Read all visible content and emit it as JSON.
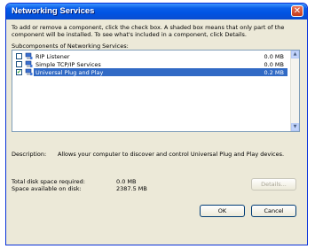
{
  "window": {
    "title": "Networking Services",
    "close_glyph": "✕"
  },
  "intro_text": "To add or remove a component, click the check box. A shaded box means that only part of the component will be installed. To see what's included in a component, click Details.",
  "subcomponents_label": "Subcomponents of Networking Services:",
  "components": [
    {
      "name": "RIP Listener",
      "size": "0.0 MB",
      "checked": false,
      "selected": false,
      "icon": "network-computer-icon"
    },
    {
      "name": "Simple TCP/IP Services",
      "size": "0.0 MB",
      "checked": false,
      "selected": false,
      "icon": "network-computer-icon"
    },
    {
      "name": "Universal Plug and Play",
      "size": "0.2 MB",
      "checked": true,
      "selected": true,
      "icon": "network-computer-icon"
    }
  ],
  "description": {
    "label": "Description:",
    "text": "Allows your computer to discover and control Universal Plug and Play devices."
  },
  "disk": {
    "required_label": "Total disk space required:",
    "required_value": "0.0 MB",
    "available_label": "Space available on disk:",
    "available_value": "2387.5 MB"
  },
  "buttons": {
    "details": "Details...",
    "ok": "OK",
    "cancel": "Cancel"
  }
}
